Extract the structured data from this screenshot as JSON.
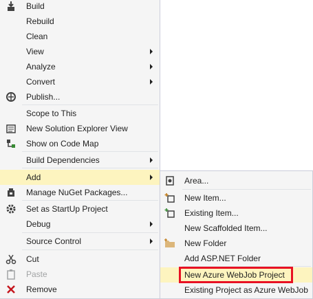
{
  "main_menu": {
    "items": [
      {
        "label": "Build",
        "icon": "build-icon"
      },
      {
        "label": "Rebuild"
      },
      {
        "label": "Clean"
      },
      {
        "label": "View",
        "submenu": true
      },
      {
        "label": "Analyze",
        "submenu": true
      },
      {
        "label": "Convert",
        "submenu": true
      },
      {
        "label": "Publish...",
        "icon": "globe-publish-icon"
      },
      {
        "label": "Scope to This"
      },
      {
        "label": "New Solution Explorer View",
        "icon": "solution-explorer-icon"
      },
      {
        "label": "Show on Code Map",
        "icon": "code-map-icon"
      },
      {
        "label": "Build Dependencies",
        "submenu": true
      },
      {
        "label": "Add",
        "submenu": true,
        "highlighted": true
      },
      {
        "label": "Manage NuGet Packages...",
        "icon": "nuget-icon"
      },
      {
        "label": "Set as StartUp Project",
        "icon": "gear-icon"
      },
      {
        "label": "Debug",
        "submenu": true
      },
      {
        "label": "Source Control",
        "submenu": true
      },
      {
        "label": "Cut",
        "icon": "scissors-icon"
      },
      {
        "label": "Paste",
        "icon": "paste-icon",
        "disabled": true
      },
      {
        "label": "Remove",
        "icon": "remove-x-icon"
      }
    ]
  },
  "add_submenu": {
    "items": [
      {
        "label": "Area...",
        "icon": "area-icon"
      },
      {
        "label": "New Item...",
        "icon": "new-item-icon"
      },
      {
        "label": "Existing Item...",
        "icon": "existing-item-icon"
      },
      {
        "label": "New Scaffolded Item..."
      },
      {
        "label": "New Folder",
        "icon": "folder-icon"
      },
      {
        "label": "Add ASP.NET Folder",
        "submenu": true
      },
      {
        "label": "New Azure WebJob Project",
        "highlighted": true
      },
      {
        "label": "Existing Project as Azure WebJob"
      }
    ]
  },
  "colors": {
    "menu_bg": "#f5f5f5",
    "highlight": "#fdf4bf",
    "callout": "#e81123"
  }
}
